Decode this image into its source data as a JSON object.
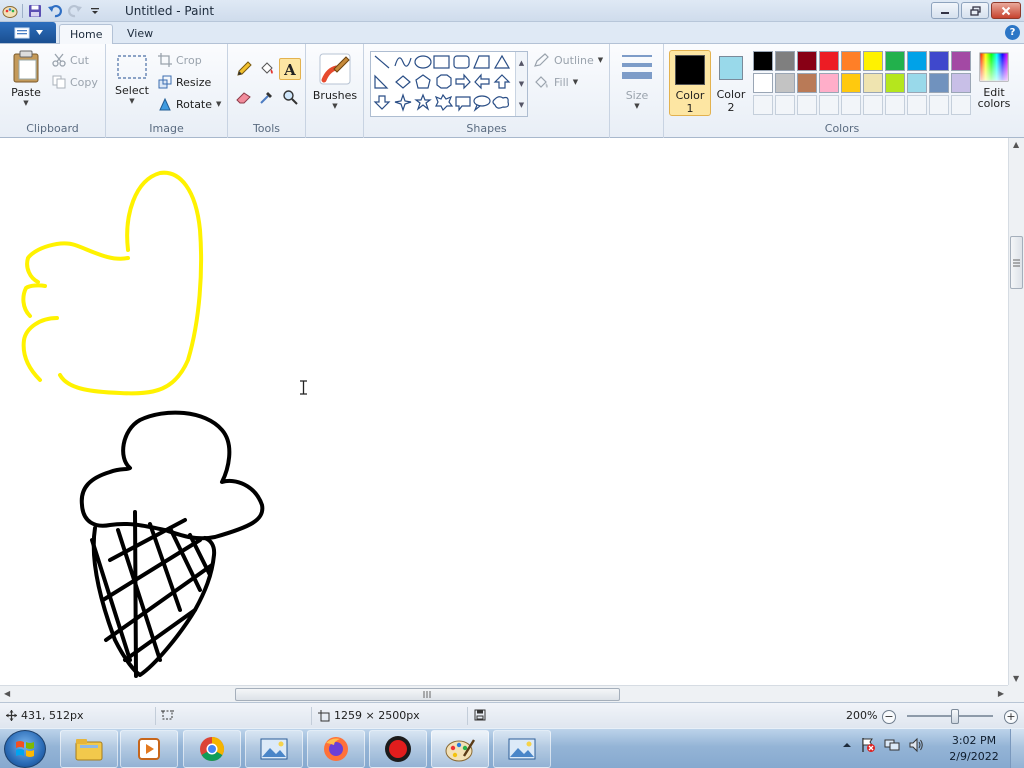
{
  "window": {
    "title": "Untitled - Paint"
  },
  "tabs": {
    "home": "Home",
    "view": "View"
  },
  "ribbon": {
    "clipboard": {
      "group": "Clipboard",
      "paste": "Paste",
      "cut": "Cut",
      "copy": "Copy"
    },
    "image": {
      "group": "Image",
      "select": "Select",
      "crop": "Crop",
      "resize": "Resize",
      "rotate": "Rotate"
    },
    "tools": {
      "group": "Tools"
    },
    "brushes": {
      "label": "Brushes"
    },
    "shapes": {
      "group": "Shapes",
      "outline": "Outline",
      "fill": "Fill"
    },
    "size": {
      "label": "Size"
    },
    "colors": {
      "group": "Colors",
      "color1_line1": "Color",
      "color1_line2": "1",
      "color2_line1": "Color",
      "color2_line2": "2",
      "edit_line1": "Edit",
      "edit_line2": "colors",
      "color1_value": "#000000",
      "color2_value": "#99d9ea",
      "palette_row1": [
        "#000000",
        "#7f7f7f",
        "#880015",
        "#ed1c24",
        "#ff7f27",
        "#fff200",
        "#22b14c",
        "#00a2e8",
        "#3f48cc",
        "#a349a4"
      ],
      "palette_row2": [
        "#ffffff",
        "#c3c3c3",
        "#b97a57",
        "#ffaec9",
        "#ffc90e",
        "#efe4b0",
        "#b5e61d",
        "#99d9ea",
        "#7092be",
        "#c8bfe7"
      ]
    }
  },
  "drawing": {
    "yellow_color": "#fff200",
    "black_color": "#000000"
  },
  "status": {
    "cursor_pos": "431, 512px",
    "canvas_size": "1259 × 2500px",
    "zoom": "200%"
  },
  "taskbar": {
    "time": "3:02 PM",
    "date": "2/9/2022"
  }
}
